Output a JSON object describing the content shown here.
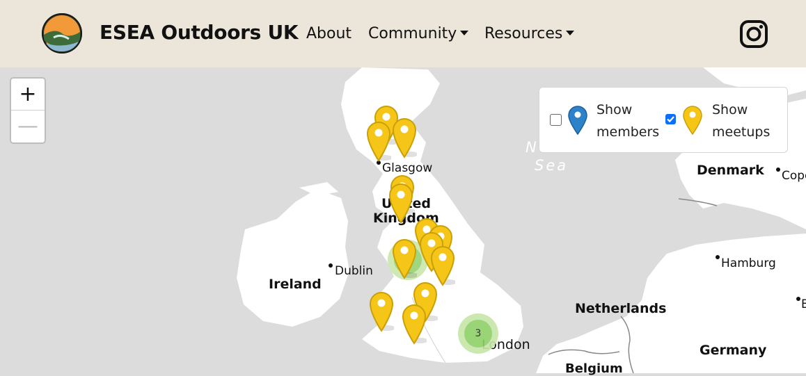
{
  "brand": {
    "name": "ESEA Outdoors UK",
    "logo_icon": "esea-logo-icon"
  },
  "nav": {
    "about": "About",
    "community": "Community",
    "resources": "Resources"
  },
  "social": {
    "icon": "instagram-icon"
  },
  "zoom": {
    "in": "+",
    "out": "—"
  },
  "legend": {
    "members": {
      "label1": "Show",
      "label2": "members",
      "checked": false,
      "color": "#2d82c9"
    },
    "meetups": {
      "label1": "Show",
      "label2": "meetups",
      "checked": true,
      "color": "#f5c518"
    }
  },
  "map": {
    "places": {
      "glasgow": "Glasgow",
      "uk1": "United",
      "uk2": "Kingdom",
      "dublin": "Dublin",
      "ireland": "Ireland",
      "london": "London",
      "denmark": "Denmark",
      "cope": "Cope",
      "hamburg": "Hamburg",
      "netherlands": "Netherlands",
      "germany": "Germany",
      "belgium": "Belgium",
      "b": "B",
      "sea1": "N",
      "sea2": "Sea"
    },
    "cluster_label": "3",
    "colors": {
      "land": "#ffffff",
      "water": "#dcdcdc",
      "cluster_outer": "#c6e6a8",
      "cluster_inner": "#8fd068"
    }
  }
}
